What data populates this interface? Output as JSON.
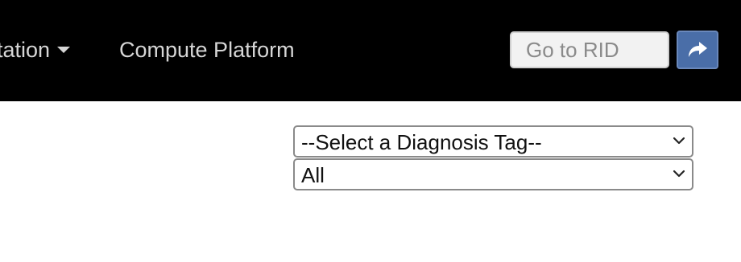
{
  "navbar": {
    "menu_partial_label": "tation",
    "compute_label": "Compute Platform",
    "rid_search": {
      "placeholder": "Go to RID",
      "value": ""
    },
    "go_button_icon": "share-arrow-icon",
    "background_color": "#000000",
    "go_button_color": "#4a6ea8"
  },
  "filters": {
    "diagnosis_tag_select": {
      "selected": "--Select a Diagnosis Tag--"
    },
    "scope_select": {
      "selected": "All"
    }
  }
}
